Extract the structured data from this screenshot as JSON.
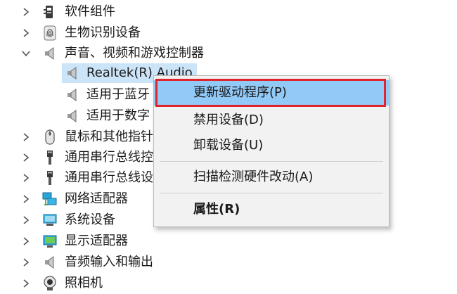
{
  "tree": {
    "rows": [
      {
        "label": "软件组件",
        "icon": "software-component-icon",
        "expanded": false
      },
      {
        "label": "生物识别设备",
        "icon": "fingerprint-icon",
        "expanded": false
      },
      {
        "label": "声音、视频和游戏控制器",
        "icon": "speaker-icon",
        "expanded": true
      },
      {
        "label": "Realtek(R) Audio",
        "icon": "speaker-icon",
        "selected": true
      },
      {
        "label": "适用于蓝牙",
        "icon": "speaker-icon"
      },
      {
        "label": "适用于数字",
        "icon": "speaker-icon"
      },
      {
        "label": "鼠标和其他指针",
        "icon": "mouse-icon",
        "expanded": false
      },
      {
        "label": "通用串行总线控",
        "icon": "usb-icon",
        "expanded": false
      },
      {
        "label": "通用串行总线设",
        "icon": "usb-icon",
        "expanded": false
      },
      {
        "label": "网络适配器",
        "icon": "network-adapter-icon",
        "expanded": false
      },
      {
        "label": "系统设备",
        "icon": "system-device-icon",
        "expanded": false
      },
      {
        "label": "显示适配器",
        "icon": "display-adapter-icon",
        "expanded": false
      },
      {
        "label": "音频输入和输出",
        "icon": "speaker-icon",
        "expanded": false
      },
      {
        "label": "照相机",
        "icon": "camera-icon",
        "expanded": false
      }
    ]
  },
  "context_menu": {
    "items": [
      {
        "label": "更新驱动程序(P)",
        "highlighted": true
      },
      {
        "label": "禁用设备(D)"
      },
      {
        "label": "卸载设备(U)"
      },
      {
        "label": "扫描检测硬件改动(A)"
      },
      {
        "label": "属性(R)",
        "bold": true
      }
    ]
  },
  "colors": {
    "selection": "#cce4f7",
    "menu_hover": "#91c9f7",
    "annotation_outline": "#e0242b",
    "menu_background": "#f2f2f2"
  }
}
